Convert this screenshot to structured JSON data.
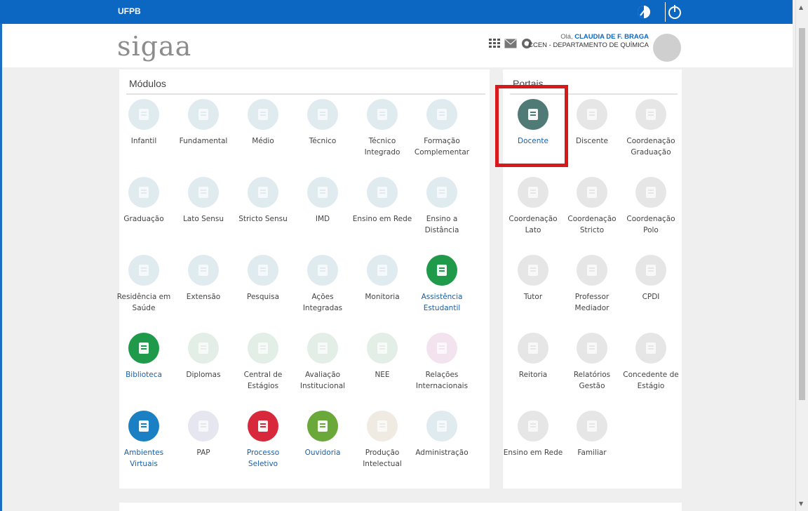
{
  "topbar": {
    "org": "UFPB"
  },
  "header": {
    "logo": "sigaa",
    "greeting": "Olá,",
    "user_name": "CLAUDIA DE F. BRAGA",
    "department": "CCEN - DEPARTAMENTO DE QUÍMICA"
  },
  "modules": {
    "title": "Módulos",
    "items": [
      {
        "label": "Infantil",
        "icon": "abc-blocks-icon",
        "color": "#e0ebf0",
        "active": false
      },
      {
        "label": "Fundamental",
        "icon": "microscope-icon",
        "color": "#e0ebf0",
        "active": false
      },
      {
        "label": "Médio",
        "icon": "book-icon",
        "color": "#e0ebf0",
        "active": false
      },
      {
        "label": "Técnico",
        "icon": "pencil-icon",
        "color": "#e0ebf0",
        "active": false
      },
      {
        "label": "Técnico Integrado",
        "icon": "tools-icon",
        "color": "#e0ebf0",
        "active": false
      },
      {
        "label": "Formação Complementar",
        "icon": "calculator-icon",
        "color": "#e0ebf0",
        "active": false
      },
      {
        "label": "Graduação",
        "icon": "graduation-cap-icon",
        "color": "#e0ebf0",
        "active": false
      },
      {
        "label": "Lato Sensu",
        "icon": "caps-icon",
        "color": "#e0ebf0",
        "active": false
      },
      {
        "label": "Stricto Sensu",
        "icon": "caps-stack-icon",
        "color": "#e0ebf0",
        "active": false
      },
      {
        "label": "IMD",
        "icon": "imd-logo-icon",
        "color": "#e0ebf0",
        "active": false
      },
      {
        "label": "Ensino em Rede",
        "icon": "globe-at-icon",
        "color": "#e0ebf0",
        "active": false
      },
      {
        "label": "Ensino a Distância",
        "icon": "ead-icon",
        "color": "#e0ebf0",
        "active": false
      },
      {
        "label": "Residência em Saúde",
        "icon": "doctor-icon",
        "color": "#e0ebf0",
        "active": false
      },
      {
        "label": "Extensão",
        "icon": "building-icon",
        "color": "#e0ebf0",
        "active": false
      },
      {
        "label": "Pesquisa",
        "icon": "flask-icon",
        "color": "#e0ebf0",
        "active": false
      },
      {
        "label": "Ações Integradas",
        "icon": "people-cycle-icon",
        "color": "#e0ebf0",
        "active": false
      },
      {
        "label": "Monitoria",
        "icon": "teacher-board-icon",
        "color": "#e0ebf0",
        "active": false
      },
      {
        "label": "Assistência Estudantil",
        "icon": "group-icon",
        "color": "#1f9a4a",
        "active": true
      },
      {
        "label": "Biblioteca",
        "icon": "books-icon",
        "color": "#1f9a4a",
        "active": true
      },
      {
        "label": "Diplomas",
        "icon": "diploma-icon",
        "color": "#e3efe6",
        "active": false
      },
      {
        "label": "Central de Estágios",
        "icon": "id-card-icon",
        "color": "#e3efe6",
        "active": false
      },
      {
        "label": "Avaliação Institucional",
        "icon": "clipboard-icon",
        "color": "#e3efe6",
        "active": false
      },
      {
        "label": "NEE",
        "icon": "wheelchair-icon",
        "color": "#e3efe6",
        "active": false
      },
      {
        "label": "Relações Internacionais",
        "icon": "people-globe-icon",
        "color": "#f3e3ef",
        "active": false
      },
      {
        "label": "Ambientes Virtuais",
        "icon": "chat-bubbles-icon",
        "color": "#1a7fc3",
        "active": true
      },
      {
        "label": "PAP",
        "icon": "presentation-icon",
        "color": "#e6e6f0",
        "active": false
      },
      {
        "label": "Processo Seletivo",
        "icon": "edit-form-icon",
        "color": "#d8283c",
        "active": true
      },
      {
        "label": "Ouvidoria",
        "icon": "headset-icon",
        "color": "#6aa83a",
        "active": true
      },
      {
        "label": "Produção Intelectual",
        "icon": "lightbulb-icon",
        "color": "#efeae2",
        "active": false
      },
      {
        "label": "Administração",
        "icon": "wrench-icon",
        "color": "#e0ebf0",
        "active": false
      }
    ]
  },
  "portals": {
    "title": "Portais",
    "items": [
      {
        "label": "Docente",
        "icon": "teacher-desk-icon",
        "color": "#4f7a76",
        "active": true
      },
      {
        "label": "Discente",
        "icon": "student-icon",
        "color": "#e6e6e6",
        "active": false
      },
      {
        "label": "Coordenação Graduação",
        "icon": "graduation-cap-icon",
        "color": "#e6e6e6",
        "active": false
      },
      {
        "label": "Coordenação Lato",
        "icon": "caps-icon",
        "color": "#e6e6e6",
        "active": false
      },
      {
        "label": "Coordenação Stricto",
        "icon": "caps-stack-icon",
        "color": "#e6e6e6",
        "active": false
      },
      {
        "label": "Coordenação Polo",
        "icon": "ead-icon",
        "color": "#e6e6e6",
        "active": false
      },
      {
        "label": "Tutor",
        "icon": "ead-tutor-icon",
        "color": "#e6e6e6",
        "active": false
      },
      {
        "label": "Professor Mediador",
        "icon": "imd-logo-icon",
        "color": "#e6e6e6",
        "active": false
      },
      {
        "label": "CPDI",
        "icon": "cpdi-icon",
        "color": "#e6e6e6",
        "active": false
      },
      {
        "label": "Reitoria",
        "icon": "r-icon",
        "color": "#e6e6e6",
        "active": false
      },
      {
        "label": "Relatórios Gestão",
        "icon": "document-icon",
        "color": "#e6e6e6",
        "active": false
      },
      {
        "label": "Concedente de Estágio",
        "icon": "id-card-icon",
        "color": "#e6e6e6",
        "active": false
      },
      {
        "label": "Ensino em Rede",
        "icon": "globe-at-icon",
        "color": "#e6e6e6",
        "active": false
      },
      {
        "label": "Familiar",
        "icon": "family-icon",
        "color": "#e6e6e6",
        "active": false
      }
    ]
  }
}
